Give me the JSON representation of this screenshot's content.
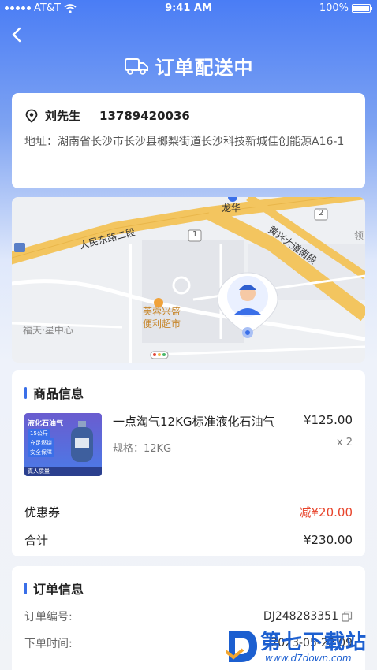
{
  "status_bar": {
    "carrier": "AT&T",
    "time": "9:41 AM",
    "battery": "100%",
    "battery_level": 1.0
  },
  "header": {
    "title": "订单配送中"
  },
  "address": {
    "name": "刘先生",
    "phone": "13789420036",
    "address_text": "地址：湖南省长沙市长沙县榔梨街道长沙科技新城佳创能源A16-1"
  },
  "map": {
    "labels": {
      "road1": "人民东路二段",
      "road2": "黄兴大道南段",
      "area1": "龙华",
      "area2": "福天·星中心",
      "poi_line1": "芙蓉兴盛",
      "poi_line2": "便利超市",
      "edge": "领",
      "marker_1": "1",
      "marker_2": "2"
    }
  },
  "goods": {
    "section_title": "商品信息",
    "product_name": "一点淘气12KG标准液化石油气",
    "price": "¥125.00",
    "quantity": "x 2",
    "spec": "规格：12KG",
    "image_texts": {
      "title": "液化石油气",
      "tag1": "15公斤",
      "tag2": "充足燃烧",
      "tag3": "安全保障",
      "footer": "真人质量"
    },
    "coupon_label": "优惠券",
    "coupon_value": "减¥20.00",
    "total_label": "合计",
    "total_value": "¥230.00"
  },
  "order": {
    "section_title": "订单信息",
    "number_label": "订单编号:",
    "number_value": "DJ248283351",
    "time_label": "下单时间:",
    "time_value": "2023-05-22 09"
  },
  "watermark": {
    "text": "第七下载站",
    "url": "www.d7down.com"
  },
  "colors": {
    "accent": "#3a6fe8",
    "discount": "#e8452c",
    "header_blue": "#4a7df5"
  }
}
